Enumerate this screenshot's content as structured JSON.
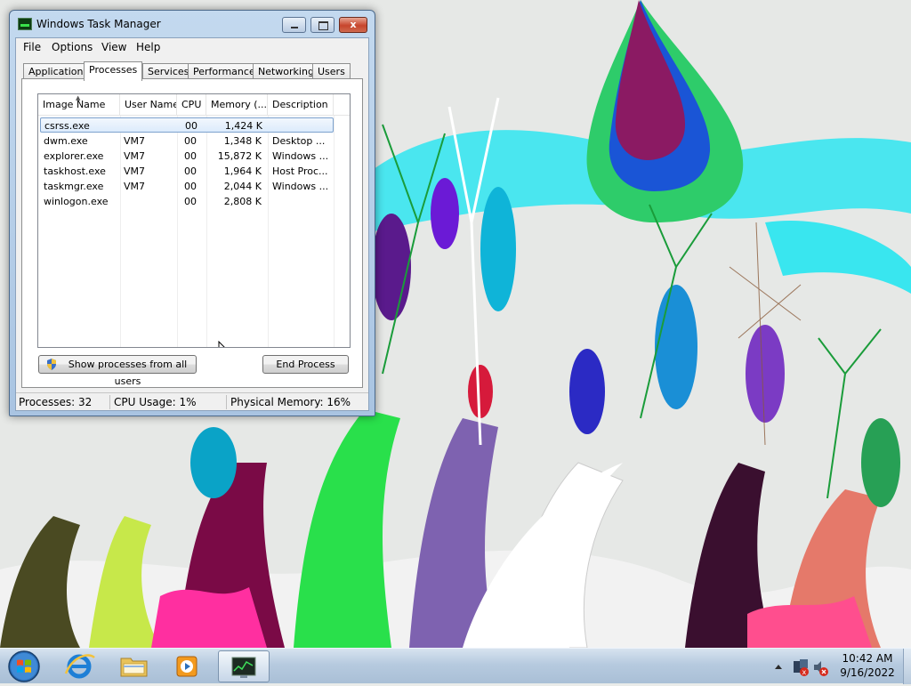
{
  "window": {
    "title": "Windows Task Manager",
    "controls": {
      "minimize": "minimize",
      "maximize": "maximize",
      "close": "x"
    }
  },
  "menu": [
    "File",
    "Options",
    "View",
    "Help"
  ],
  "tabs": [
    "Applications",
    "Processes",
    "Services",
    "Performance",
    "Networking",
    "Users"
  ],
  "active_tab": "Processes",
  "columns": [
    "Image Name",
    "User Name",
    "CPU",
    "Memory (...",
    "Description"
  ],
  "processes": [
    {
      "image": "csrss.exe",
      "user": "",
      "cpu": "00",
      "memory": "1,424 K",
      "description": ""
    },
    {
      "image": "dwm.exe",
      "user": "VM7",
      "cpu": "00",
      "memory": "1,348 K",
      "description": "Desktop ..."
    },
    {
      "image": "explorer.exe",
      "user": "VM7",
      "cpu": "00",
      "memory": "15,872 K",
      "description": "Windows ..."
    },
    {
      "image": "taskhost.exe",
      "user": "VM7",
      "cpu": "00",
      "memory": "1,964 K",
      "description": "Host Proc..."
    },
    {
      "image": "taskmgr.exe",
      "user": "VM7",
      "cpu": "00",
      "memory": "2,044 K",
      "description": "Windows ..."
    },
    {
      "image": "winlogon.exe",
      "user": "",
      "cpu": "00",
      "memory": "2,808 K",
      "description": ""
    }
  ],
  "selected_row": 0,
  "buttons": {
    "show_all": "Show processes from all users",
    "end_process": "End Process"
  },
  "status": {
    "processes": "Processes: 32",
    "cpu": "CPU Usage: 1%",
    "memory": "Physical Memory: 16%"
  },
  "taskbar": {
    "pinned": [
      "internet-explorer-icon",
      "windows-explorer-icon",
      "media-player-icon",
      "task-manager-icon"
    ],
    "active": "task-manager-icon"
  },
  "clock": {
    "time": "10:42 AM",
    "date": "9/16/2022"
  },
  "colors": {
    "selection": "#dcebfc",
    "selection_border": "#7da2ce",
    "close_button": "#c7452c"
  }
}
